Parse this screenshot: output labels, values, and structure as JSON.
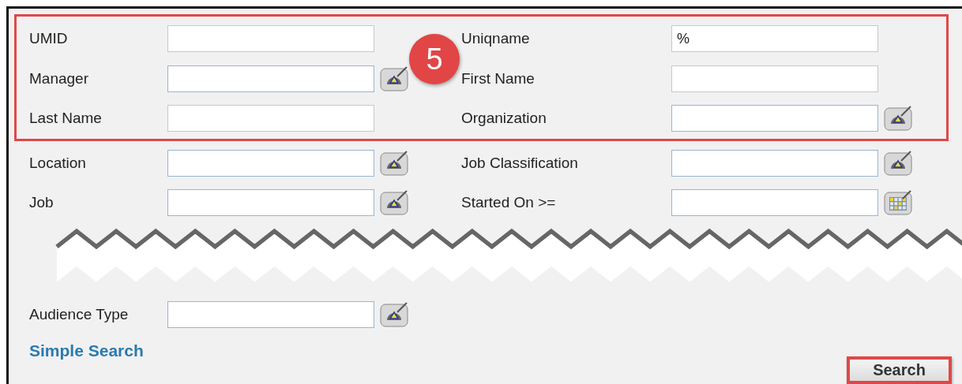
{
  "sections": [
    {
      "kind": "fields",
      "highlighted": true,
      "badge": "5",
      "rows": [
        {
          "left": {
            "label": "UMID",
            "kind": "plain"
          },
          "right": {
            "label": "Uniqname",
            "value": "%",
            "kind": "plain"
          }
        },
        {
          "left": {
            "label": "Manager",
            "kind": "lookup"
          },
          "right": {
            "label": "First Name",
            "kind": "plain"
          }
        },
        {
          "left": {
            "label": "Last Name",
            "kind": "plain"
          },
          "right": {
            "label": "Organization",
            "kind": "lookup"
          }
        }
      ]
    },
    {
      "kind": "fields",
      "highlighted": false,
      "rows": [
        {
          "left": {
            "label": "Location",
            "kind": "lookup"
          },
          "right": {
            "label": "Job Classification",
            "kind": "lookup"
          }
        },
        {
          "left": {
            "label": "Job",
            "kind": "lookup"
          },
          "right": {
            "label": "Started On >=",
            "kind": "calendar"
          }
        }
      ]
    },
    {
      "kind": "tear"
    },
    {
      "kind": "fields",
      "highlighted": false,
      "rows": [
        {
          "left": {
            "label": "Audience Type",
            "kind": "lookup"
          }
        }
      ]
    }
  ],
  "simple_search_link": "Simple Search",
  "search_button": {
    "label": "Search",
    "highlighted": true
  }
}
